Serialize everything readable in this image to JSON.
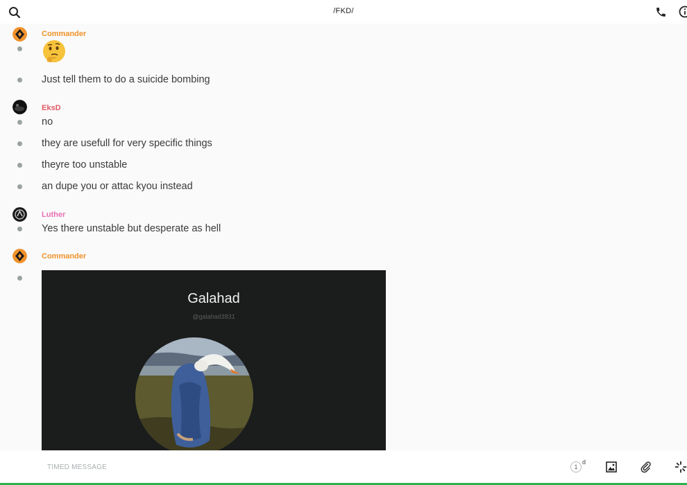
{
  "header": {
    "title": "/FKD/",
    "icons": [
      "search-icon",
      "phone-icon",
      "info-icon"
    ]
  },
  "messages": [
    {
      "author": "Commander",
      "author_color": "#f0922b",
      "emoji": "thinking-face-emoji",
      "lines": [
        "Just tell them to do a suicide bombing"
      ]
    },
    {
      "author": "EksD",
      "author_color": "#e05a64",
      "lines": [
        "no",
        "they are usefull for very specific things",
        "theyre too unstable",
        "an dupe you or attac kyou instead"
      ]
    },
    {
      "author": "Luther",
      "author_color": "#e86fb4",
      "lines": [
        "Yes there unstable but desperate as hell"
      ]
    },
    {
      "author": "Commander",
      "author_color": "#f0922b",
      "attachment": {
        "name": "Galahad",
        "handle": "@galahad3831",
        "image": "profile-photo-goose-figure"
      }
    }
  ],
  "composer": {
    "placeholder": "TIMED MESSAGE",
    "timer_value": "1",
    "timer_unit": "d",
    "icons": [
      "timer-icon",
      "image-icon",
      "attachment-icon",
      "sparkle-icon"
    ]
  },
  "colors": {
    "accent_green": "#2bb24c",
    "bullet": "#9aa3a0",
    "background": "#fafafa"
  }
}
